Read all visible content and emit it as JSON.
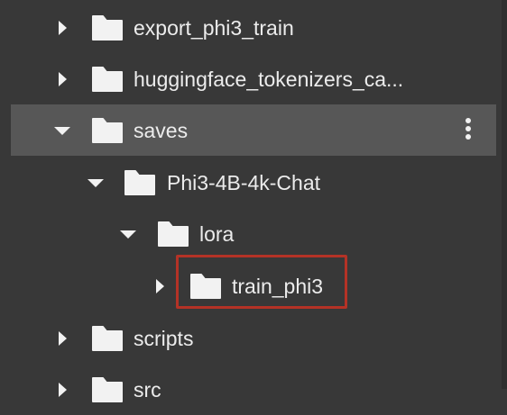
{
  "tree": {
    "items": [
      {
        "label": "export_phi3_train",
        "expanded": false,
        "icon": "folder-icon",
        "chevron": "chevron-right-icon"
      },
      {
        "label": "huggingface_tokenizers_ca...",
        "expanded": false,
        "icon": "folder-icon",
        "chevron": "chevron-right-icon"
      },
      {
        "label": "saves",
        "expanded": true,
        "selected": true,
        "icon": "folder-icon",
        "chevron": "chevron-down-icon",
        "menu_icon": "more-vertical-icon"
      },
      {
        "label": "Phi3-4B-4k-Chat",
        "expanded": true,
        "icon": "folder-icon",
        "chevron": "chevron-down-icon"
      },
      {
        "label": "lora",
        "expanded": true,
        "icon": "folder-icon",
        "chevron": "chevron-down-icon"
      },
      {
        "label": "train_phi3",
        "expanded": false,
        "highlighted": true,
        "icon": "folder-icon",
        "chevron": "chevron-right-icon"
      },
      {
        "label": "scripts",
        "expanded": false,
        "icon": "folder-icon",
        "chevron": "chevron-right-icon"
      },
      {
        "label": "src",
        "expanded": false,
        "icon": "folder-icon",
        "chevron": "chevron-right-icon"
      }
    ]
  },
  "colors": {
    "background": "#383838",
    "selected_row": "#575757",
    "text": "#ececec",
    "folder": "#f2f2f2",
    "highlight_border": "#b43226"
  }
}
